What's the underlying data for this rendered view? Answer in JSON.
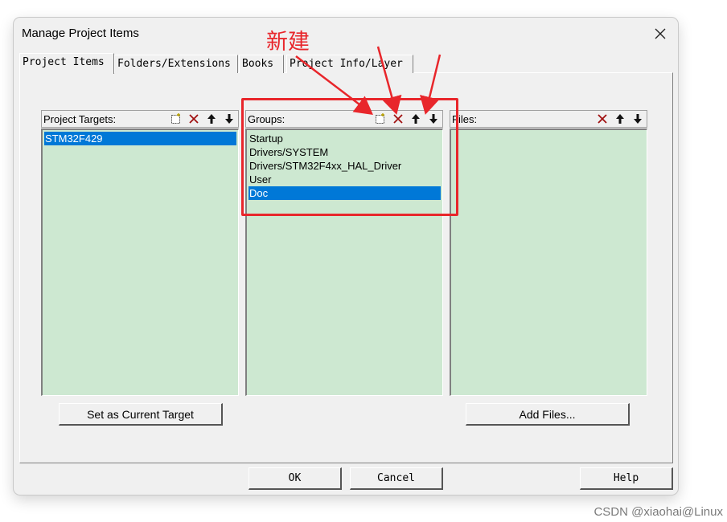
{
  "dialog": {
    "title": "Manage Project Items",
    "tabs": [
      "Project Items",
      "Folders/Extensions",
      "Books",
      "Project Info/Layer"
    ],
    "active_tab": "Project Items"
  },
  "targets": {
    "label": "Project Targets:",
    "items": [
      "STM32F429"
    ],
    "selected": "STM32F429"
  },
  "groups": {
    "label": "Groups:",
    "items": [
      "Startup",
      "Drivers/SYSTEM",
      "Drivers/STM32F4xx_HAL_Driver",
      "User",
      "Doc"
    ],
    "selected": "Doc"
  },
  "files": {
    "label": "Files:",
    "items": []
  },
  "buttons": {
    "set_target": "Set as Current Target",
    "add_files": "Add Files...",
    "ok": "OK",
    "cancel": "Cancel",
    "help": "Help"
  },
  "annotation": {
    "label": "新建",
    "color": "#e8262b"
  },
  "watermark": "CSDN @xiaohai@Linux",
  "colors": {
    "list_bg": "#cde8d1",
    "selection": "#0078d7"
  }
}
